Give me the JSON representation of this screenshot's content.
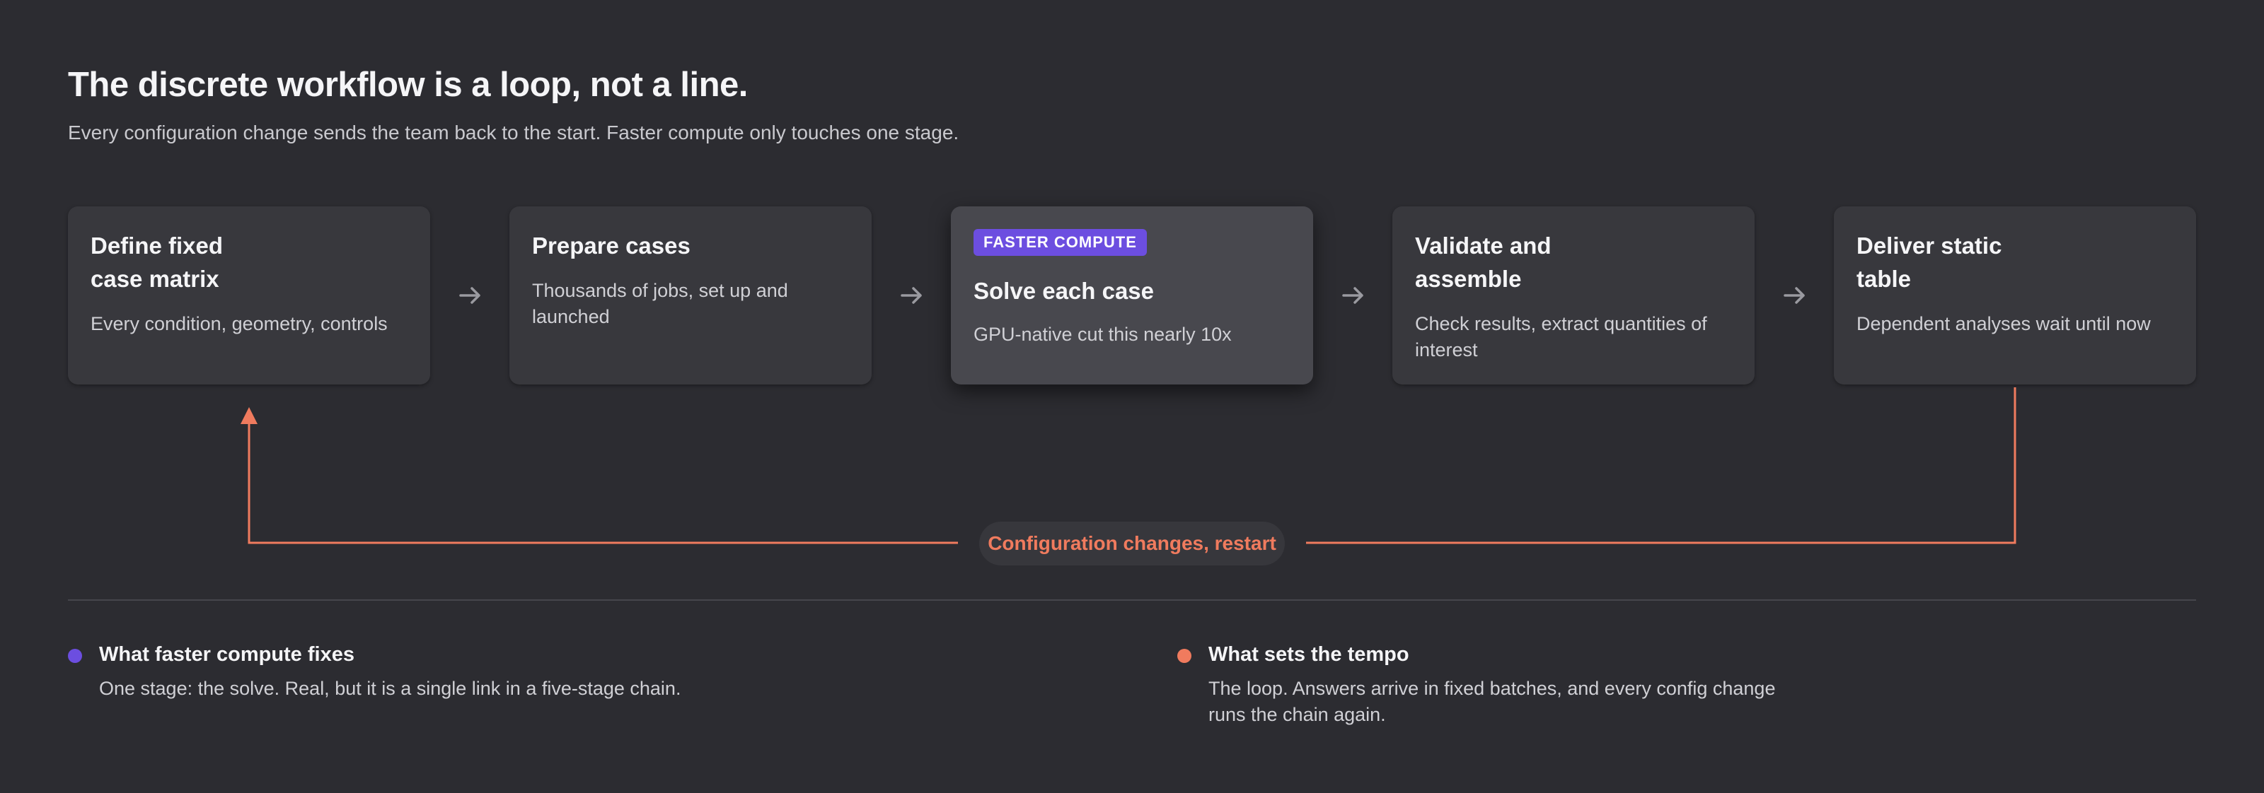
{
  "header": {
    "title": "The discrete workflow is a loop, not a line.",
    "subtitle": "Every configuration change sends the team back to the start. Faster compute only touches one stage."
  },
  "stages": [
    {
      "title": "Define fixed\ncase matrix",
      "desc": "Every condition, geometry, controls"
    },
    {
      "title": "Prepare cases",
      "desc": "Thousands of jobs, set up and launched"
    },
    {
      "badge": "FASTER COMPUTE",
      "title": "Solve each case",
      "desc": "GPU-native cut this nearly 10x"
    },
    {
      "title": "Validate and\nassemble",
      "desc": "Check results, extract quantities of interest"
    },
    {
      "title": "Deliver static\ntable",
      "desc": "Dependent analyses wait until now"
    }
  ],
  "loop": {
    "label": "Configuration changes, restart"
  },
  "notes": [
    {
      "title": "What faster compute fixes",
      "body": "One stage: the solve. Real, but it is a single link in a five-stage chain."
    },
    {
      "title": "What sets the tempo",
      "body": "The loop. Answers arrive in fixed batches, and every config change runs the chain again."
    }
  ],
  "colors": {
    "background": "#2c2c31",
    "card": "#38383d",
    "card_highlight": "#48484e",
    "accent_purple": "#6c4ee0",
    "accent_coral": "#f07b5e",
    "arrow": "#9a9aa0"
  },
  "icons": {
    "step_arrow": "arrow-right-icon",
    "loop_arrowhead": "arrow-up-icon"
  }
}
